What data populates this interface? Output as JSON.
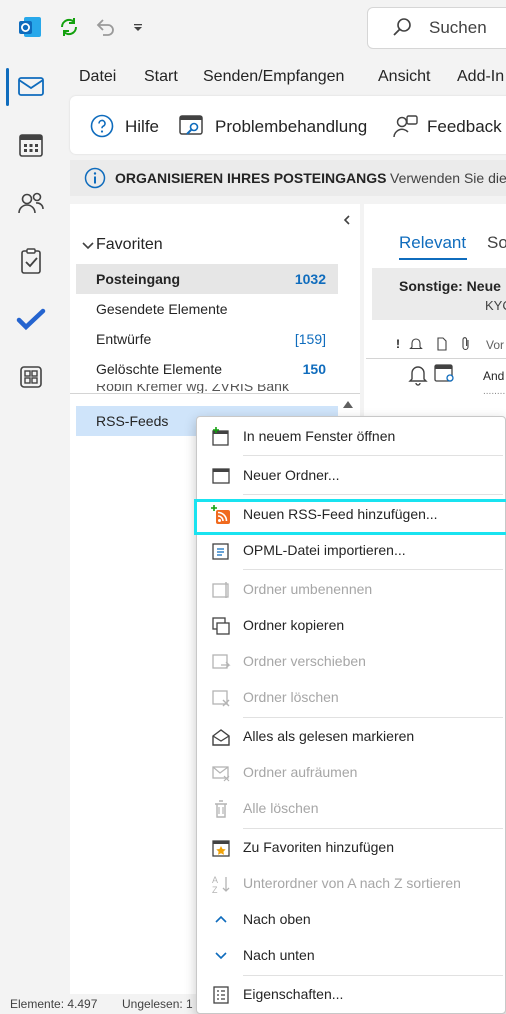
{
  "search": {
    "placeholder": "Suchen"
  },
  "menu": [
    "Datei",
    "Start",
    "Senden/Empfangen",
    "Ansicht",
    "Add-In"
  ],
  "ribbon": {
    "help": "Hilfe",
    "troubleshoot": "Problembehandlung",
    "feedback": "Feedback"
  },
  "infobar": {
    "title": "ORGANISIEREN IHRES POSTEINGANGS",
    "text": "Verwenden Sie die"
  },
  "folders": {
    "favorites_label": "Favoriten",
    "items": [
      {
        "label": "Posteingang",
        "count": "1032"
      },
      {
        "label": "Gesendete Elemente",
        "count": ""
      },
      {
        "label": "Entwürfe",
        "count": "[159]"
      },
      {
        "label": "Gelöschte Elemente",
        "count": "150"
      },
      {
        "label": "Robin Kremer wg. ZVRIS Bank",
        "count": ""
      },
      {
        "label": "RSS-Feeds",
        "count": ""
      }
    ]
  },
  "messages": {
    "tab_relevant": "Relevant",
    "tab_other": "So",
    "group_title": "Sonstige: Neue",
    "group_sub": "KYC",
    "col_from": "Vor",
    "row_sender": "And"
  },
  "status": {
    "elements": "Elemente: 4.497",
    "unread": "Ungelesen: 1"
  },
  "context_menu": [
    {
      "label": "In neuem Fenster öffnen",
      "enabled": true
    },
    {
      "label": "Neuer Ordner...",
      "enabled": true
    },
    {
      "label": "Neuen RSS-Feed hinzufügen...",
      "enabled": true
    },
    {
      "label": "OPML-Datei importieren...",
      "enabled": true
    },
    {
      "label": "Ordner umbenennen",
      "enabled": false
    },
    {
      "label": "Ordner kopieren",
      "enabled": true
    },
    {
      "label": "Ordner verschieben",
      "enabled": false
    },
    {
      "label": "Ordner löschen",
      "enabled": false
    },
    {
      "label": "Alles als gelesen markieren",
      "enabled": true
    },
    {
      "label": "Ordner aufräumen",
      "enabled": false
    },
    {
      "label": "Alle löschen",
      "enabled": false
    },
    {
      "label": "Zu Favoriten hinzufügen",
      "enabled": true
    },
    {
      "label": "Unterordner von A nach Z sortieren",
      "enabled": false
    },
    {
      "label": "Nach oben",
      "enabled": true
    },
    {
      "label": "Nach unten",
      "enabled": true
    },
    {
      "label": "Eigenschaften...",
      "enabled": true
    }
  ],
  "colors": {
    "accent": "#0f6cbd",
    "highlight": "#19e3f0",
    "selection": "#cfe4fa",
    "rss": "#f06a1e"
  }
}
